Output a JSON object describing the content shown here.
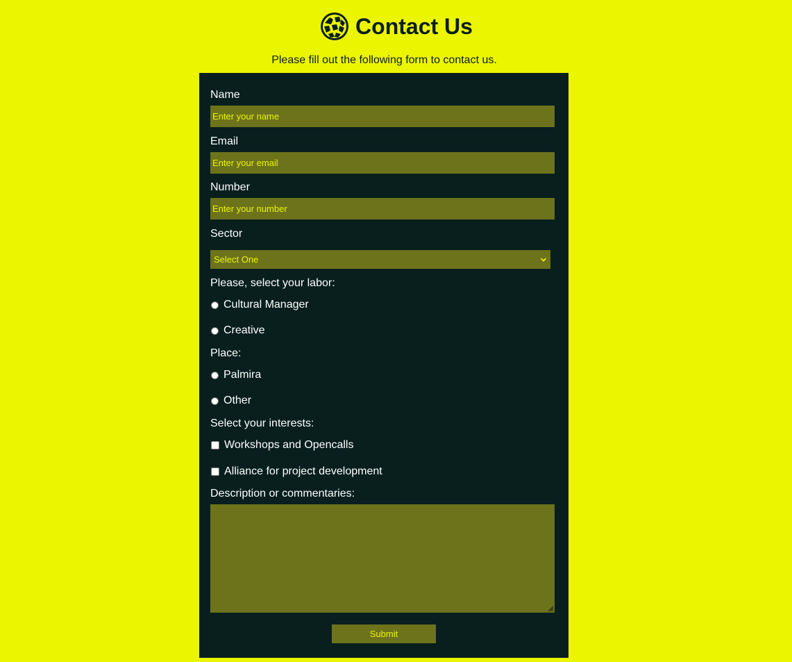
{
  "page": {
    "title": "Contact Us",
    "subtitle": "Please fill out the following form to contact us.",
    "logo_icon": "globe-mosaic-icon"
  },
  "form": {
    "name": {
      "label": "Name",
      "placeholder": "Enter your name",
      "value": ""
    },
    "email": {
      "label": "Email",
      "placeholder": "Enter your email",
      "value": ""
    },
    "number": {
      "label": "Number",
      "placeholder": "Enter your number",
      "value": ""
    },
    "sector": {
      "label": "Sector",
      "selected": "Select One",
      "icon": "chevron-down-icon"
    },
    "labor": {
      "label": "Please, select your labor:",
      "options": [
        {
          "label": "Cultural Manager",
          "checked": false
        },
        {
          "label": "Creative",
          "checked": false
        }
      ]
    },
    "place": {
      "label": "Place:",
      "options": [
        {
          "label": "Palmira",
          "checked": false
        },
        {
          "label": "Other",
          "checked": false
        }
      ]
    },
    "interests": {
      "label": "Select your interests:",
      "options": [
        {
          "label": "Workshops and Opencalls",
          "checked": false
        },
        {
          "label": "Alliance for project development",
          "checked": false
        }
      ]
    },
    "description": {
      "label": "Description or commentaries:",
      "value": ""
    },
    "submit_label": "Submit"
  },
  "colors": {
    "background": "#ecf500",
    "card": "#081f1e",
    "field": "#6d731b",
    "accent_text": "#ecf500",
    "label_text": "#ffffff",
    "heading_text": "#0a1f1e"
  }
}
